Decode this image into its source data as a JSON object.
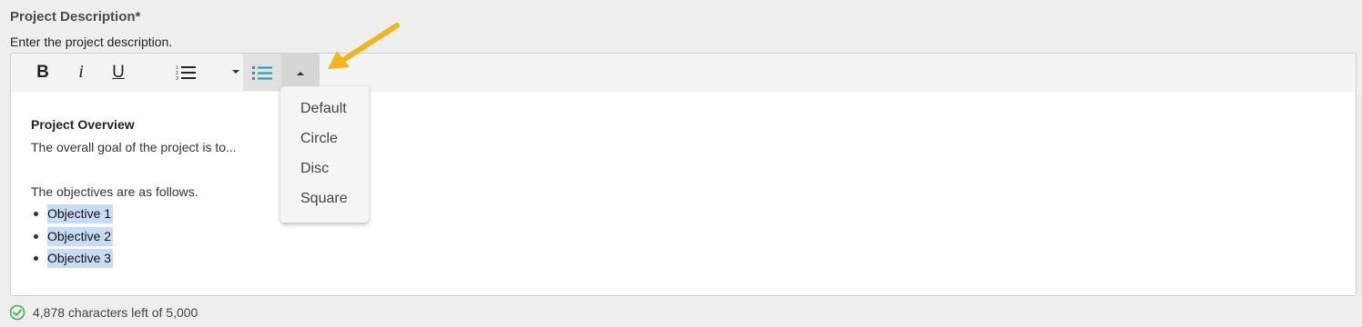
{
  "field": {
    "label": "Project Description*",
    "help": "Enter the project description."
  },
  "toolbar": {
    "bold_label": "B",
    "italic_label": "i",
    "underline_label": "U",
    "ordered_list_icon": "ordered-list-icon",
    "bullet_list_icon": "bullet-list-icon"
  },
  "content": {
    "heading": "Project Overview",
    "paragraph1": "The overall goal of the project is to...",
    "paragraph2": "The objectives are as follows.",
    "objectives": [
      "Objective 1",
      "Objective 2",
      "Objective 3"
    ]
  },
  "bullet_style_menu": {
    "options": [
      "Default",
      "Circle",
      "Disc",
      "Square"
    ]
  },
  "footer": {
    "status": "4,878 characters left of 5,000"
  },
  "colors": {
    "accent": "#1a9bb0",
    "selection": "#c8dcf7",
    "success": "#3bb54a",
    "annotation_arrow": "#f2b51c"
  }
}
